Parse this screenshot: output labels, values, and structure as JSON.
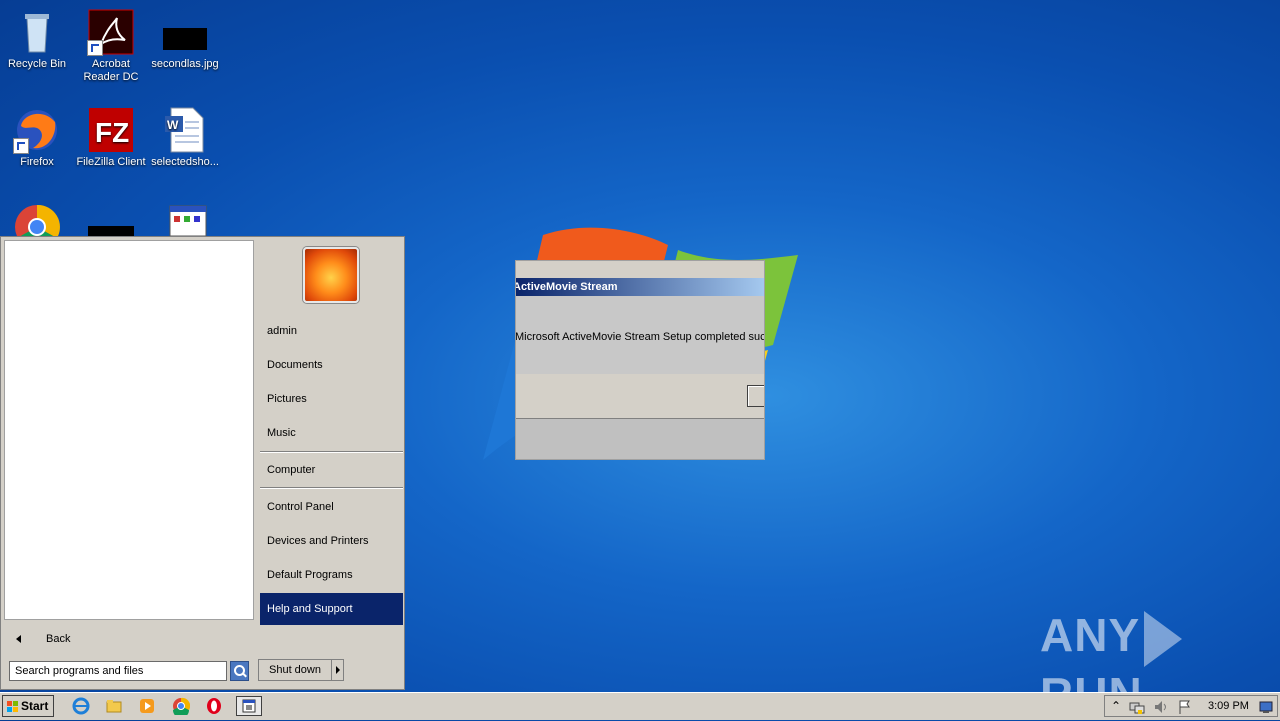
{
  "desktop": {
    "icons": [
      {
        "label": "Recycle Bin",
        "icon": "recycle-bin-icon"
      },
      {
        "label": "Acrobat Reader DC",
        "icon": "acrobat-icon"
      },
      {
        "label": "secondlas.jpg",
        "icon": "image-file-icon"
      },
      {
        "label": "Firefox",
        "icon": "firefox-icon"
      },
      {
        "label": "FileZilla Client",
        "icon": "filezilla-icon"
      },
      {
        "label": "selectedsho...",
        "icon": "word-document-icon"
      }
    ]
  },
  "start_menu": {
    "back_label": "Back",
    "search_placeholder": "Search programs and files",
    "shutdown_label": "Shut down",
    "right_items": [
      {
        "label": "admin"
      },
      {
        "label": "Documents"
      },
      {
        "label": "Pictures"
      },
      {
        "label": "Music"
      },
      {
        "label": "Computer"
      },
      {
        "label": "Control Panel"
      },
      {
        "label": "Devices and Printers"
      },
      {
        "label": "Default Programs"
      },
      {
        "label": "Help and Support",
        "highlighted": true
      }
    ]
  },
  "dialog": {
    "title": "ActiveMovie Stream",
    "message": "Microsoft ActiveMovie Stream Setup completed succ"
  },
  "taskbar": {
    "start_label": "Start",
    "pinned": [
      "internet-explorer-icon",
      "explorer-icon",
      "media-player-icon",
      "chrome-icon",
      "opera-icon",
      "window-icon"
    ],
    "clock": "3:09 PM"
  },
  "watermark": {
    "left": "ANY",
    "right": "RUN"
  },
  "colors": {
    "selection": "#0a246a",
    "title_gradient_start": "#0a246a",
    "title_gradient_end": "#a6caf0"
  }
}
